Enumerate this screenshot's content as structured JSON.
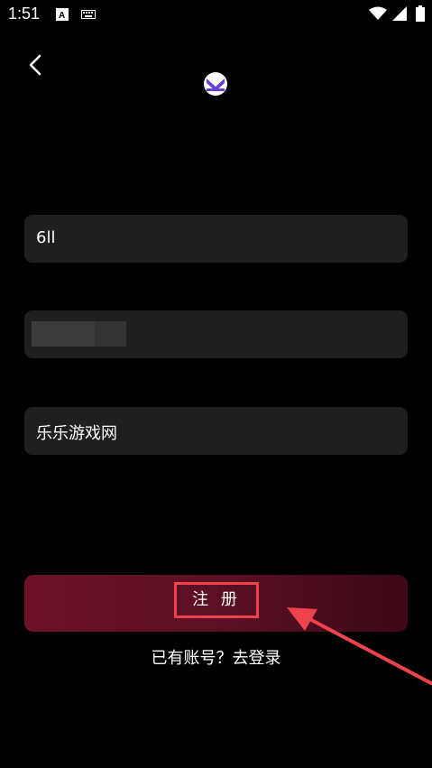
{
  "status_bar": {
    "time": "1:51",
    "icons": [
      "a-notification-icon",
      "keyboard-icon",
      "wifi-icon",
      "signal-icon",
      "battery-icon"
    ]
  },
  "header": {
    "back_icon": "back-arrow-icon",
    "logo_icon": "app-logo-icon"
  },
  "form": {
    "username_value": "6ll",
    "password_value": "",
    "invite_value": "乐乐游戏网"
  },
  "actions": {
    "register_label": "注 册",
    "login_link": "已有账号？去登录"
  },
  "colors": {
    "background": "#000000",
    "field_bg": "#1f1f1f",
    "button_gradient_start": "#6d1228",
    "button_gradient_end": "#3d0817",
    "highlight_red": "#f0424c"
  }
}
